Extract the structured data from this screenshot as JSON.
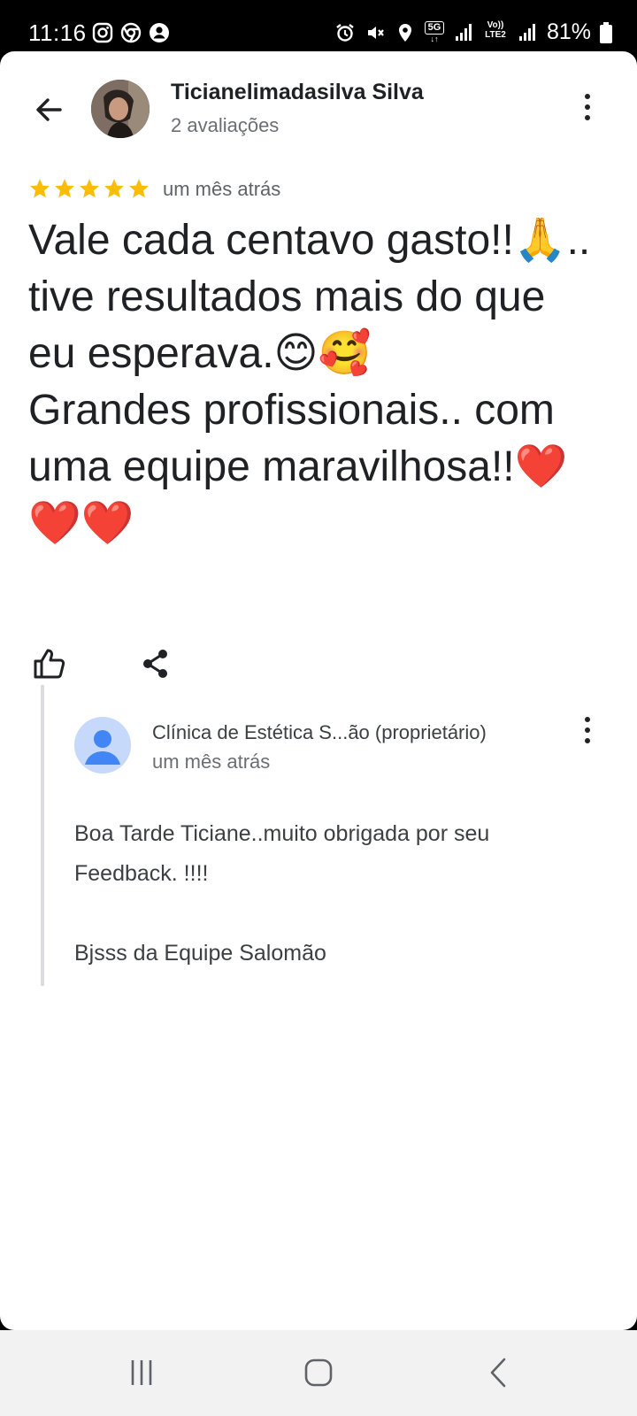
{
  "status_bar": {
    "time": "11:16",
    "left_icons": [
      "instagram-icon",
      "chrome-icon",
      "account-icon"
    ],
    "right_icons": [
      "alarm-icon",
      "mute-icon",
      "location-icon",
      "5g-icon",
      "signal-icon",
      "volte-lte2-icon",
      "signal-icon"
    ],
    "network_label": "5G",
    "volte_label_top": "Vo))",
    "volte_label_bottom": "LTE2",
    "battery_percent": "81%",
    "battery_level": 0.81
  },
  "header": {
    "user_name": "Ticianelimadasilva Silva",
    "review_count": "2 avaliações"
  },
  "review": {
    "rating": 5,
    "time": "um mês atrás",
    "text": "Vale cada centavo gasto!!🙏..\ntive resultados mais do que\neu esperava.😊🥰\nGrandes profissionais.. com\numa equipe maravilhosa!!❤️\n❤️❤️",
    "star_color": "#fbbc04"
  },
  "owner_reply": {
    "name": "Clínica de Estética S...ão (proprietário)",
    "time": "um mês atrás",
    "text": "Boa Tarde Ticiane..muito obrigada por seu\nFeedback. !!!!\n\nBjsss da Equipe Salomão",
    "avatar_color": "#c6d9fb",
    "avatar_figure_color": "#4285f4"
  },
  "icons": {
    "back": "arrow-back-icon",
    "menu": "more-vert-icon",
    "like": "thumb-up-icon",
    "share": "share-icon"
  },
  "nav_bar": {
    "recent": "recent-apps-icon",
    "home": "home-icon",
    "back": "back-icon"
  }
}
